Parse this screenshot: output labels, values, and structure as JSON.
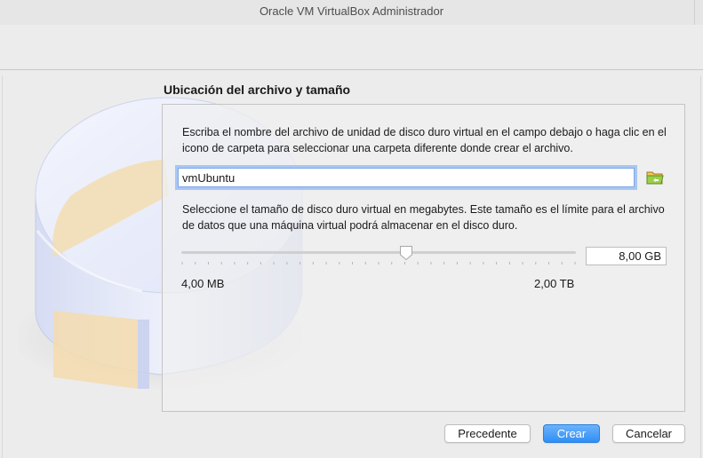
{
  "window": {
    "title": "Oracle VM VirtualBox Administrador"
  },
  "wizard": {
    "heading": "Ubicación del archivo y tamaño",
    "description_location": "Escriba el nombre del archivo de unidad de disco duro virtual en el campo debajo o haga clic en el icono de carpeta para seleccionar una carpeta diferente donde crear el archivo.",
    "file_name_value": "vmUbuntu",
    "folder_icon": "folder-icon",
    "description_size": "Seleccione el tamaño de disco duro virtual en megabytes. Este tamaño es el límite para el archivo de datos que una máquina virtual podrá almacenar en el disco duro.",
    "size_value": "8,00 GB",
    "size_slider_fraction": 0.57,
    "size_min_label": "4,00 MB",
    "size_max_label": "2,00 TB"
  },
  "buttons": {
    "previous": "Precedente",
    "create": "Crear",
    "cancel": "Cancelar"
  },
  "colors": {
    "accent": "#2f8ff5",
    "focus_ring": "#a8c6f3",
    "folder": "#8fbf3a"
  }
}
